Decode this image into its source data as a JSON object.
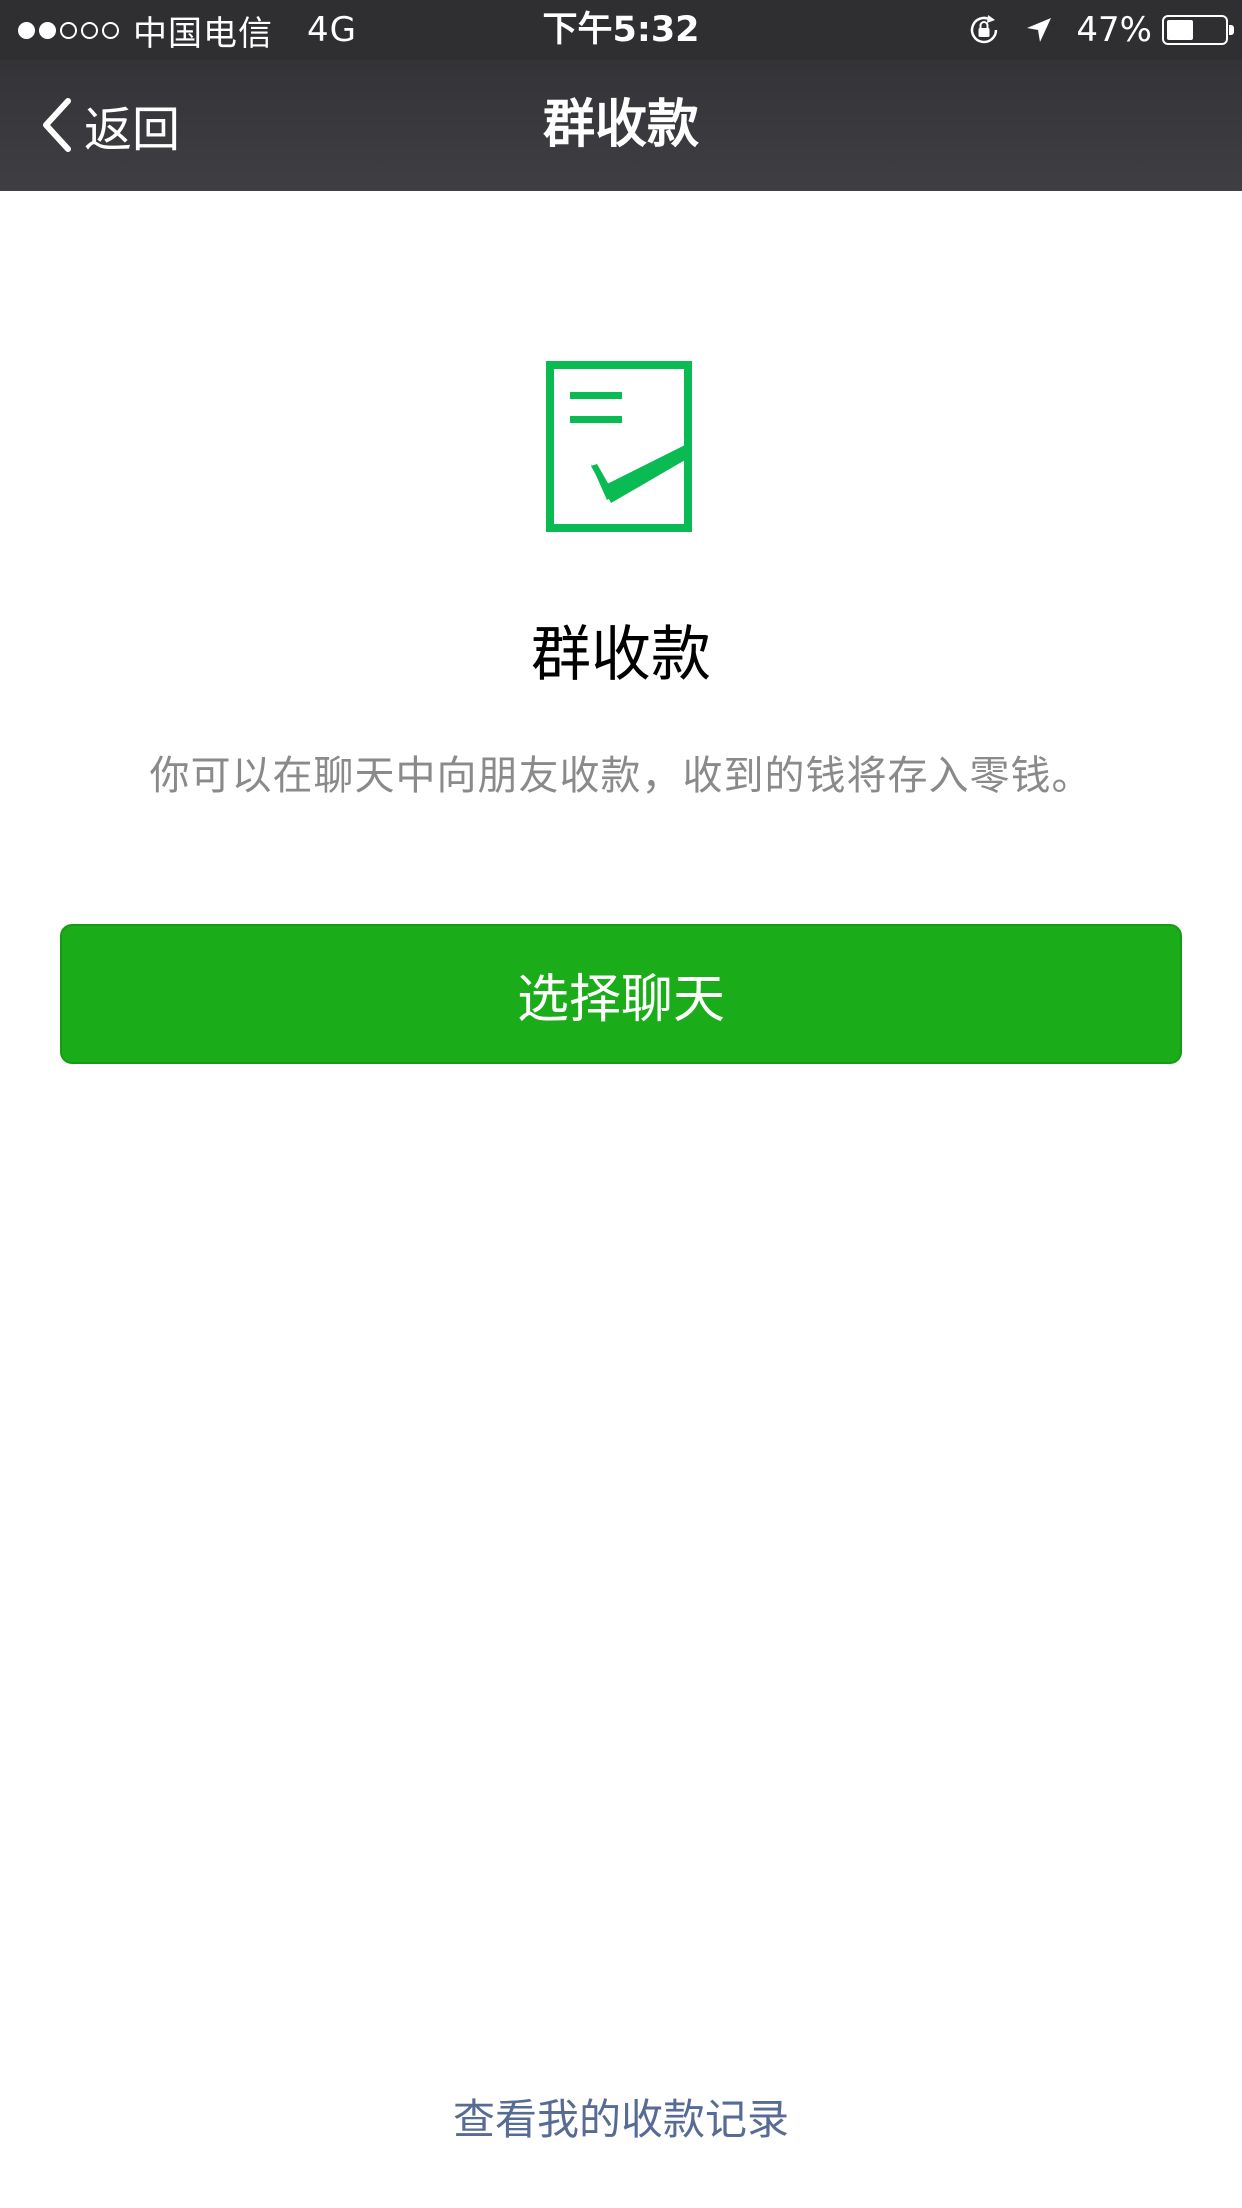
{
  "status_bar": {
    "signal_bars": [
      true,
      true,
      false,
      false,
      false
    ],
    "carrier": "中国电信",
    "network": "4G",
    "time": "下午5:32",
    "battery_percent_label": "47%",
    "battery_level": 0.47
  },
  "nav": {
    "back_label": "返回",
    "title": "群收款"
  },
  "main": {
    "icon": "document-check-icon",
    "title": "群收款",
    "description": "你可以在聊天中向朋友收款，收到的钱将存入零钱。",
    "button_label": "选择聊天"
  },
  "footer": {
    "records_link": "查看我的收款记录"
  },
  "colors": {
    "accent_green": "#1aad19",
    "icon_green": "#09bb52",
    "link_blue": "#576b95",
    "nav_bg": "#3a3a3e"
  }
}
